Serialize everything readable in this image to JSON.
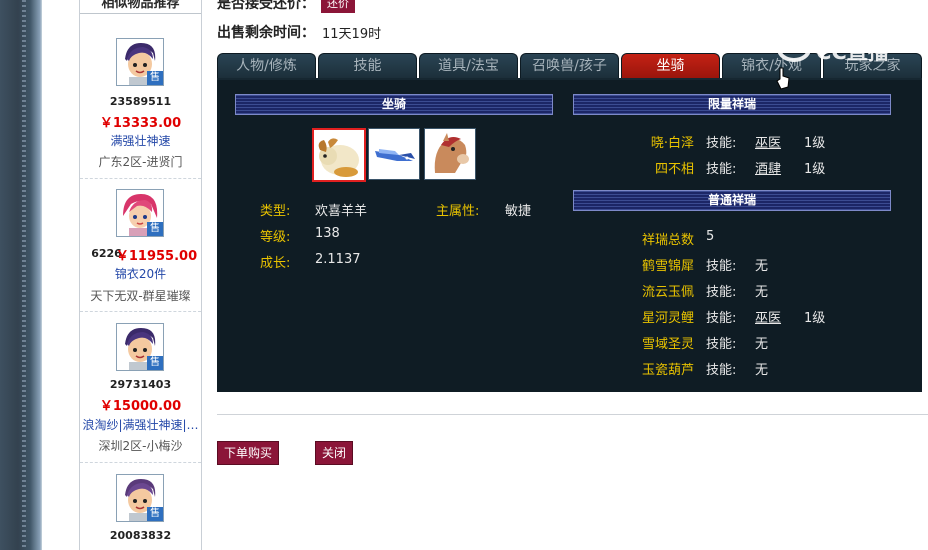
{
  "sidebar": {
    "title": "相似物品推荐",
    "items": [
      {
        "id": "23589511",
        "price": "￥13333.00",
        "desc": "满强壮神速",
        "server": "广东2区-进贤门"
      },
      {
        "id": "6226",
        "price": "￥11955.00",
        "desc": "锦衣20件",
        "server": "天下无双-群星璀璨"
      },
      {
        "id": "29731403",
        "price": "￥15000.00",
        "desc": "浪淘纱|满强壮神速|…",
        "server": "深圳2区-小梅沙"
      },
      {
        "id": "20083832",
        "price": "",
        "desc": "",
        "server": ""
      }
    ],
    "sell_badge": "售"
  },
  "top": {
    "accept_counter_label": "是否接受还价：",
    "counter_button": "还价",
    "sale_time_label": "出售剩余时间：",
    "sale_time_value": "11天19时"
  },
  "tabs": [
    {
      "label": "人物/修炼",
      "active": false
    },
    {
      "label": "技能",
      "active": false
    },
    {
      "label": "道具/法宝",
      "active": false
    },
    {
      "label": "召唤兽/孩子",
      "active": false
    },
    {
      "label": "坐骑",
      "active": true
    },
    {
      "label": "锦衣/外观",
      "active": false
    },
    {
      "label": "玩家之家",
      "active": false
    }
  ],
  "mount_panel": {
    "header": "坐骑",
    "type_label": "类型:",
    "type_value": "欢喜羊羊",
    "main_attr_label": "主属性:",
    "main_attr_value": "敏捷",
    "level_label": "等级:",
    "level_value": "138",
    "growth_label": "成长:",
    "growth_value": "2.1137"
  },
  "limited_panel": {
    "header": "限量祥瑞",
    "rows": [
      {
        "name": "晓·白泽",
        "skill_label": "技能:",
        "skill": "巫医",
        "level": "1级"
      },
      {
        "name": "四不相",
        "skill_label": "技能:",
        "skill": "酒肆",
        "level": "1级"
      }
    ]
  },
  "normal_panel": {
    "header": "普通祥瑞",
    "total_label": "祥瑞总数",
    "total_value": "5",
    "rows": [
      {
        "name": "鹤雪锦犀",
        "skill_label": "技能:",
        "skill": "无",
        "level": ""
      },
      {
        "name": "流云玉佩",
        "skill_label": "技能:",
        "skill": "无",
        "level": ""
      },
      {
        "name": "星河灵鲤",
        "skill_label": "技能:",
        "skill": "巫医",
        "level": "1级"
      },
      {
        "name": "雪域圣灵",
        "skill_label": "技能:",
        "skill": "无",
        "level": ""
      },
      {
        "name": "玉瓷葫芦",
        "skill_label": "技能:",
        "skill": "无",
        "level": ""
      }
    ]
  },
  "actions": {
    "buy": "下单购买",
    "close": "关闭"
  },
  "watermark": "CC直播",
  "colors": {
    "accent_red": "#8b1538",
    "price_red": "#e00000",
    "gold_label": "#e8c200",
    "panel_bg": "#0f1c24",
    "active_tab": "#c42215"
  }
}
